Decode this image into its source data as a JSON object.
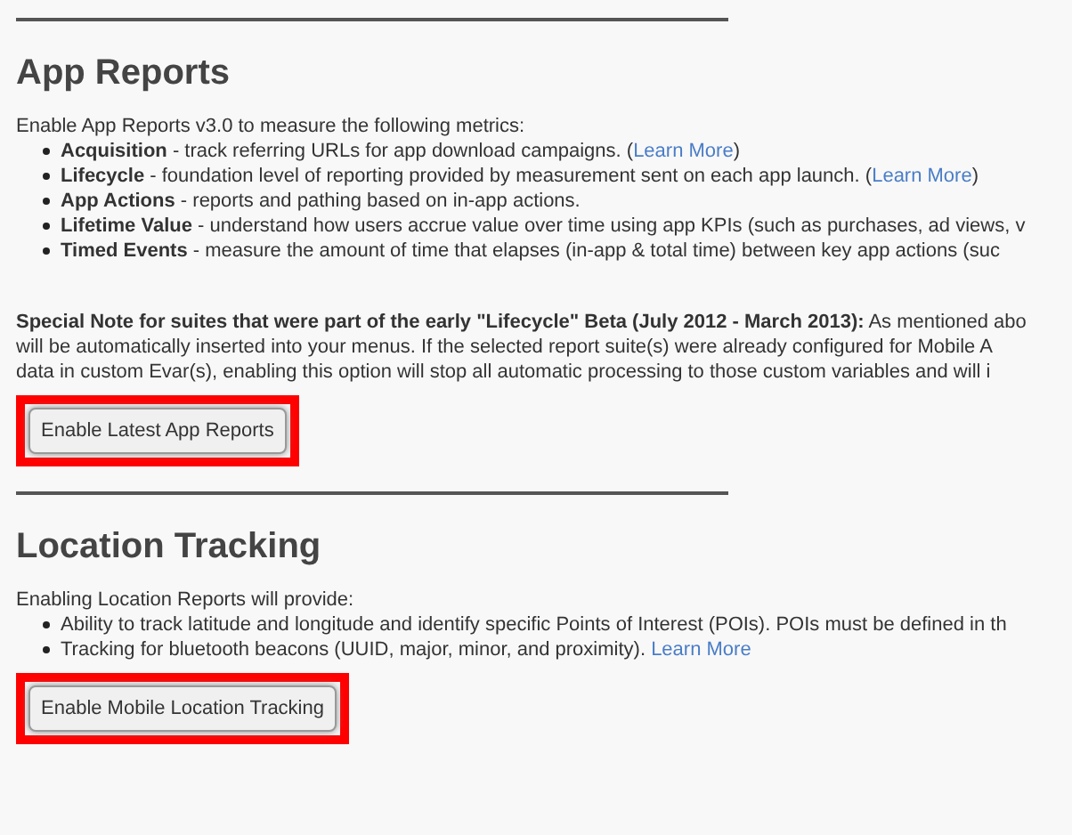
{
  "sections": [
    {
      "title": "App Reports",
      "intro": "Enable App Reports v3.0 to measure the following metrics:",
      "items": [
        {
          "term": "Acquisition",
          "text": " - track referring URLs for app download campaigns. (",
          "link": "Learn More",
          "after": ")"
        },
        {
          "term": "Lifecycle",
          "text": " - foundation level of reporting provided by measurement sent on each app launch. (",
          "link": "Learn More",
          "after": ")"
        },
        {
          "term": "App Actions",
          "text": " - reports and pathing based on in-app actions."
        },
        {
          "term": "Lifetime Value",
          "text": " - understand how users accrue value over time using app KPIs (such as purchases, ad views, v"
        },
        {
          "term": "Timed Events",
          "text": " - measure the amount of time that elapses (in-app & total time) between key app actions (suc"
        }
      ],
      "note": "**Special Note for suites that were part of the early \"Lifecycle\" Beta (July 2012 - March 2013):** As mentioned abo will be automatically inserted into your menus. If the selected report suite(s) were already configured for Mobile A data in custom Evar(s), enabling this option will stop all automatic processing to those custom variables and will i",
      "button": {
        "label": "Enable Latest App Reports",
        "highlighted": true
      }
    },
    {
      "title": "Location Tracking",
      "intro": "Enabling Location Reports will provide:",
      "items": [
        {
          "text": "Ability to track latitude and longitude and identify specific Points of Interest (POIs). POIs must be defined in th"
        },
        {
          "text": "Tracking for bluetooth beacons (UUID, major, minor, and proximity). ",
          "link": "Learn More"
        }
      ],
      "button": {
        "label": "Enable Mobile Location Tracking",
        "highlighted": true
      }
    }
  ]
}
